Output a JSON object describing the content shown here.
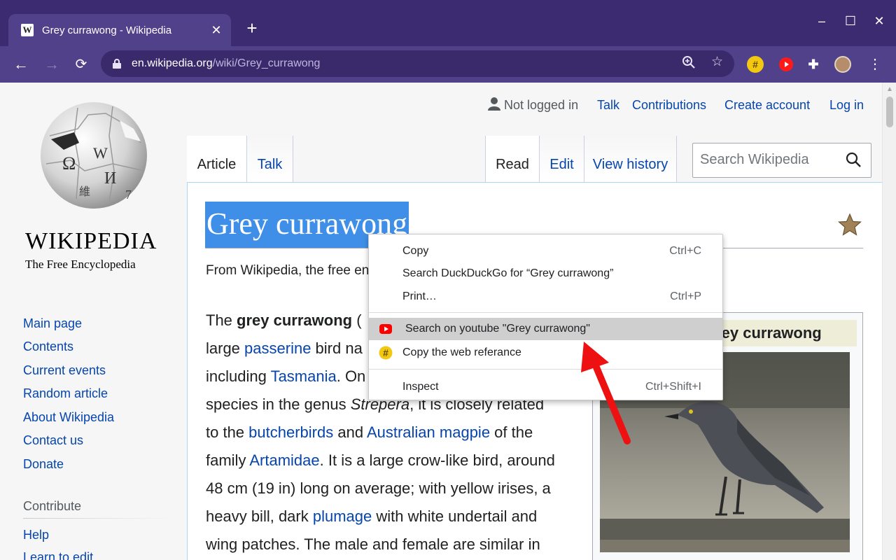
{
  "browser": {
    "tab_title": "Grey currawong - Wikipedia",
    "tab_favicon": "W",
    "tab_close": "✕",
    "new_tab": "+",
    "url_host": "en.wikipedia.org",
    "url_path": "/wiki/Grey_currawong",
    "window_controls": {
      "minimize": "–",
      "maximize": "☐",
      "close": "✕"
    },
    "icons": [
      "back-arrow-icon",
      "forward-arrow-icon",
      "reload-icon",
      "lock-icon",
      "zoom-icon",
      "bookmark-star-icon",
      "hashtag-extension-icon",
      "youtube-extension-icon",
      "extensions-puzzle-icon",
      "profile-avatar-icon",
      "menu-kebab-icon"
    ],
    "colors": {
      "tabbar": "#3c2b70",
      "toolbar": "#51408a",
      "accent_yellow": "#f2c811",
      "youtube_red": "#ff0000"
    }
  },
  "personal": {
    "not_logged_in": "Not logged in",
    "talk": "Talk",
    "contributions": "Contributions",
    "create_account": "Create account",
    "log_in": "Log in"
  },
  "logo": {
    "wordmark": "WIKIPEDIA",
    "tagline": "The Free Encyclopedia"
  },
  "sidebar": {
    "nav": [
      "Main page",
      "Contents",
      "Current events",
      "Random article",
      "About Wikipedia",
      "Contact us",
      "Donate"
    ],
    "contribute_heading": "Contribute",
    "contribute": [
      "Help",
      "Learn to edit"
    ]
  },
  "tabs": {
    "article": "Article",
    "talk": "Talk",
    "read": "Read",
    "edit": "Edit",
    "view_history": "View history"
  },
  "search": {
    "placeholder": "Search Wikipedia"
  },
  "article": {
    "title": "Grey currawong",
    "site_sub": "From Wikipedia, the free encyclopedia",
    "lines": {
      "l1_pre": "The ",
      "l1_bold": "grey currawong",
      "l1_post": " (",
      "l2_pre": "large ",
      "l2_link": "passerine",
      "l2_post": " bird na",
      "l3_pre": "including ",
      "l3_link": "Tasmania",
      "l3_post": ". On",
      "l4_pre": "species in the genus ",
      "l4_italic": "Strepera",
      "l4_post": ", it is closely related",
      "l5_pre": "to the ",
      "l5_link1": "butcherbirds",
      "l5_mid": " and ",
      "l5_link2": "Australian magpie",
      "l5_post": " of the",
      "l6_pre": "family ",
      "l6_link": "Artamidae",
      "l6_post": ". It is a large crow-like bird, around",
      "l7": "48 cm (19 in) long on average; with yellow irises, a",
      "l8_pre": "heavy bill, dark ",
      "l8_link": "plumage",
      "l8_post": " with white undertail and",
      "l9": "wing patches. The male and female are similar in"
    }
  },
  "infobox": {
    "title": "Grey currawong"
  },
  "context_menu": {
    "copy": "Copy",
    "copy_shortcut": "Ctrl+C",
    "search_ddg": "Search DuckDuckGo for “Grey currawong”",
    "print": "Print…",
    "print_shortcut": "Ctrl+P",
    "youtube": "Search on youtube \"Grey currawong\"",
    "web_ref": "Copy the web referance",
    "inspect": "Inspect",
    "inspect_shortcut": "Ctrl+Shift+I"
  }
}
